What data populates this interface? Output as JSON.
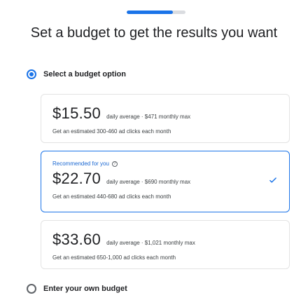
{
  "progress": {
    "fraction": 0.78
  },
  "title": "Set a budget to get the results you want",
  "options": {
    "select_budget": {
      "label": "Select a budget option",
      "checked": true
    },
    "own_budget": {
      "label": "Enter your own budget",
      "checked": false
    }
  },
  "cards": [
    {
      "price": "$15.50",
      "meta": "daily average · $471 monthly max",
      "desc": "Get an estimated 300-460 ad clicks each month",
      "recommended": false
    },
    {
      "recommended_label": "Recommended for you",
      "price": "$22.70",
      "meta": "daily average · $690 monthly max",
      "desc": "Get an estimated 440-680 ad clicks each month",
      "recommended": true
    },
    {
      "price": "$33.60",
      "meta": "daily average · $1,021 monthly max",
      "desc": "Get an estimated 650-1,000 ad clicks each month",
      "recommended": false
    }
  ],
  "colors": {
    "accent": "#1a73e8",
    "border": "#e3e3e3"
  },
  "icons": {
    "recommended_help": "help-icon",
    "selected": "check-icon"
  }
}
